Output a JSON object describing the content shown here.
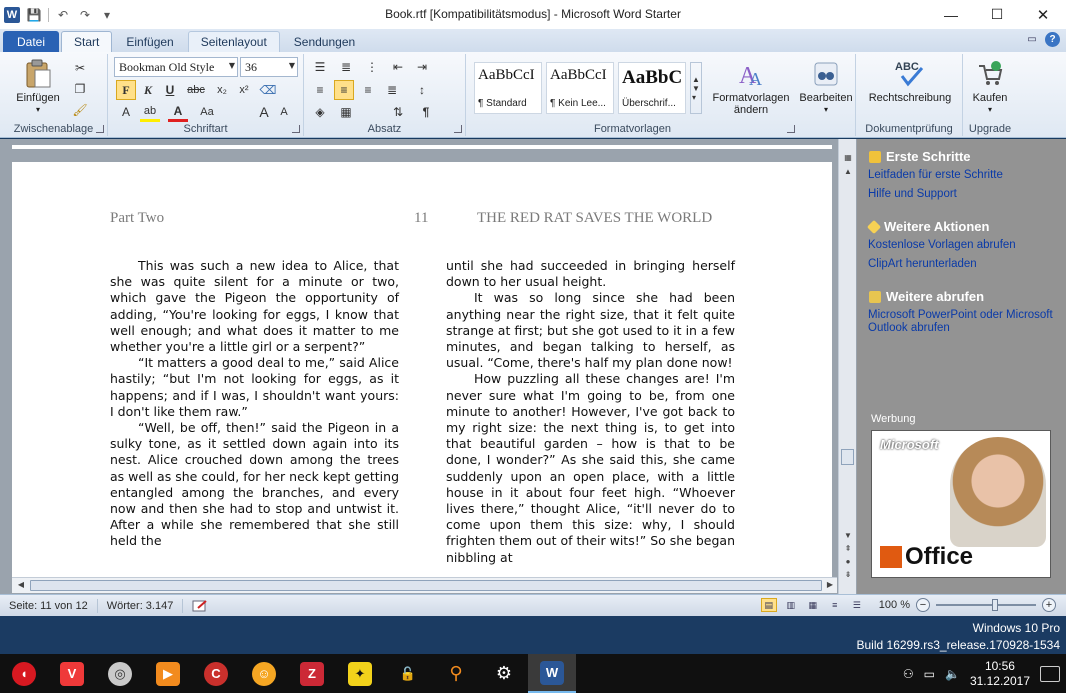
{
  "window": {
    "title": "Book.rtf [Kompatibilitätsmodus] - Microsoft Word Starter",
    "app_logo": "W"
  },
  "tabs": [
    {
      "label": "Datei"
    },
    {
      "label": "Start"
    },
    {
      "label": "Einfügen"
    },
    {
      "label": "Seitenlayout"
    },
    {
      "label": "Sendungen"
    }
  ],
  "ribbon": {
    "clipboard": {
      "paste_label": "Einfügen",
      "group_label": "Zwischenablage"
    },
    "font": {
      "font_name": "Bookman Old Style",
      "font_size": "36",
      "bold": "F",
      "italic": "K",
      "underline": "U",
      "strike": "abc",
      "sub": "x₂",
      "sup": "x²",
      "grow": "A",
      "shrink": "A",
      "case": "Aa",
      "group_label": "Schriftart"
    },
    "paragraph": {
      "group_label": "Absatz",
      "pilcrow": "¶"
    },
    "styles": {
      "items": [
        {
          "sample": "AaBbCcI",
          "name": "¶ Standard"
        },
        {
          "sample": "AaBbCcI",
          "name": "¶ Kein Lee..."
        },
        {
          "sample": "AaBbC",
          "name": "Überschrif..."
        }
      ],
      "change_label_1": "Formatvorlagen",
      "change_label_2": "ändern",
      "group_label": "Formatvorlagen"
    },
    "editing": {
      "label": "Bearbeiten"
    },
    "proofing": {
      "label": "Rechtschreibung",
      "icon_text": "ABC",
      "group_label": "Dokumentprüfung"
    },
    "upgrade": {
      "label": "Kaufen",
      "group_label": "Upgrade"
    }
  },
  "document": {
    "header_left": "Part Two",
    "header_page": "11",
    "header_right": "THE RED RAT SAVES THE WORLD",
    "col1": [
      "This was such a new idea to Alice, that she was quite silent for a minute or two, which gave the Pigeon the opportunity of adding, “You're looking for eggs, I know that well enough; and what does it matter to me whether you're a little girl or a serpent?”",
      "“It matters a good deal to me,” said Alice hastily; “but I'm not looking for eggs, as it happens; and if I was, I shouldn't want yours: I don't like them raw.”",
      "“Well, be off, then!” said the Pigeon in a sulky tone, as it settled down again into its nest. Alice crouched down among the trees as well as she could, for her neck kept getting entangled among the branches, and every now and then she had to stop and untwist it. After a while she remembered that she still held the"
    ],
    "col2_first": "until she had succeeded in bringing herself down to her usual height.",
    "col2": [
      "It was so long since she had been anything near the right size, that it felt quite strange at first; but she got used to it in a few minutes, and began talking to herself, as usual. “Come, there's half my plan done now!",
      "How puzzling all these changes are! I'm never sure what I'm going to be, from one minute to another! However, I've got back to my right size: the next thing is, to get into that beautiful garden – how is that to be done, I wonder?” As she said this, she came suddenly upon an open place, with a little house in it about four feet high. “Whoever lives there,” thought Alice, “it'll never do to come upon them this size: why, I should frighten them out of their wits!” So she began nibbling at"
    ]
  },
  "sidepane": {
    "sections": [
      {
        "title": "Erste Schritte",
        "links": [
          "Leitfaden für erste Schritte",
          "Hilfe und Support"
        ]
      },
      {
        "title": "Weitere Aktionen",
        "links": [
          "Kostenlose Vorlagen abrufen",
          "ClipArt herunterladen"
        ]
      },
      {
        "title": "Weitere abrufen",
        "links": [
          "Microsoft PowerPoint oder Microsoft Outlook abrufen"
        ]
      }
    ],
    "ad_label": "Werbung",
    "ad_brand": "Microsoft",
    "ad_product": "Office"
  },
  "status": {
    "page": "Seite: 11 von 12",
    "words": "Wörter: 3.147",
    "zoom": "100 %",
    "zoom_minus": "−",
    "zoom_plus": "+"
  },
  "desktop": {
    "edition": "Windows 10 Pro",
    "build": "Build 16299.rs3_release.170928-1534"
  },
  "taskbar": {
    "time": "10:56",
    "date": "31.12.2017"
  }
}
